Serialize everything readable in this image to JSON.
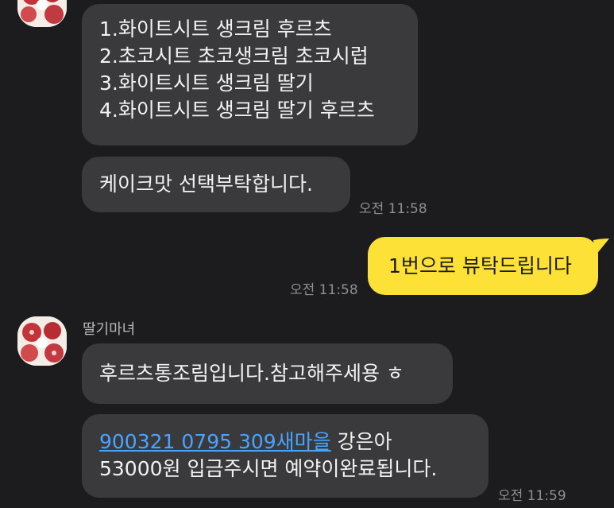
{
  "chat": {
    "messages": [
      {
        "type": "incoming",
        "lines": [
          "1.화이트시트 생크림 후르츠",
          "2.초코시트 초코생크림 초코시럽",
          "3.화이트시트 생크림 딸기",
          "4.화이트시트 생크림 딸기 후르츠"
        ]
      },
      {
        "type": "incoming",
        "text": "케이크맛 선택부탁합니다.",
        "time": "오전 11:58"
      },
      {
        "type": "outgoing",
        "text": "1번으로 뷰탁드립니다",
        "time": "오전 11:58"
      },
      {
        "type": "incoming",
        "sender": "딸기마녀",
        "text": "후르츠통조림입니다.참고해주세용 ㅎ"
      },
      {
        "type": "incoming",
        "link_text": "900321 0795 309새마을",
        "line1_rest": " 강은아",
        "line2": "53000원 입금주시면 예약이완료됩니다.",
        "time": "오전 11:59"
      }
    ]
  },
  "colors": {
    "background": "#1c1c1e",
    "incoming_bubble": "#3a3a3c",
    "outgoing_bubble": "#fde136",
    "link": "#4aa3ff",
    "timestamp": "#8e8e93"
  }
}
